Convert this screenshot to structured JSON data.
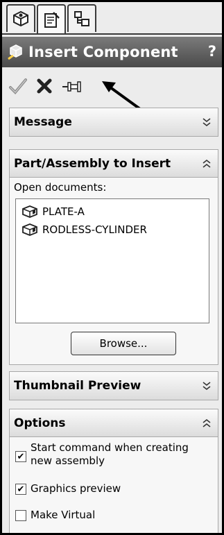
{
  "tabs": [
    {
      "icon": "feature-manager-icon"
    },
    {
      "icon": "property-manager-icon"
    },
    {
      "icon": "configuration-manager-icon"
    }
  ],
  "title_bar": {
    "title": "Insert Component",
    "help": "?"
  },
  "actions": {
    "ok_icon": "checkmark-icon",
    "cancel_icon": "x-icon",
    "pin_icon": "pushpin-icon"
  },
  "sections": {
    "message": {
      "title": "Message",
      "state": "collapsed"
    },
    "part_assembly": {
      "title": "Part/Assembly to Insert",
      "state": "expanded",
      "open_docs_label": "Open documents:",
      "documents": [
        "PLATE-A",
        "RODLESS-CYLINDER"
      ],
      "browse_label": "Browse..."
    },
    "thumbnail": {
      "title": "Thumbnail Preview",
      "state": "collapsed"
    },
    "options": {
      "title": "Options",
      "state": "expanded",
      "items": [
        {
          "label": "Start command when creating new assembly",
          "checked": true
        },
        {
          "label": "Graphics preview",
          "checked": true
        },
        {
          "label": "Make Virtual",
          "checked": false
        }
      ]
    }
  },
  "colors": {
    "title_bar": "#5a5a5a",
    "panel": "#ececec",
    "section": "#f7f7f7"
  }
}
